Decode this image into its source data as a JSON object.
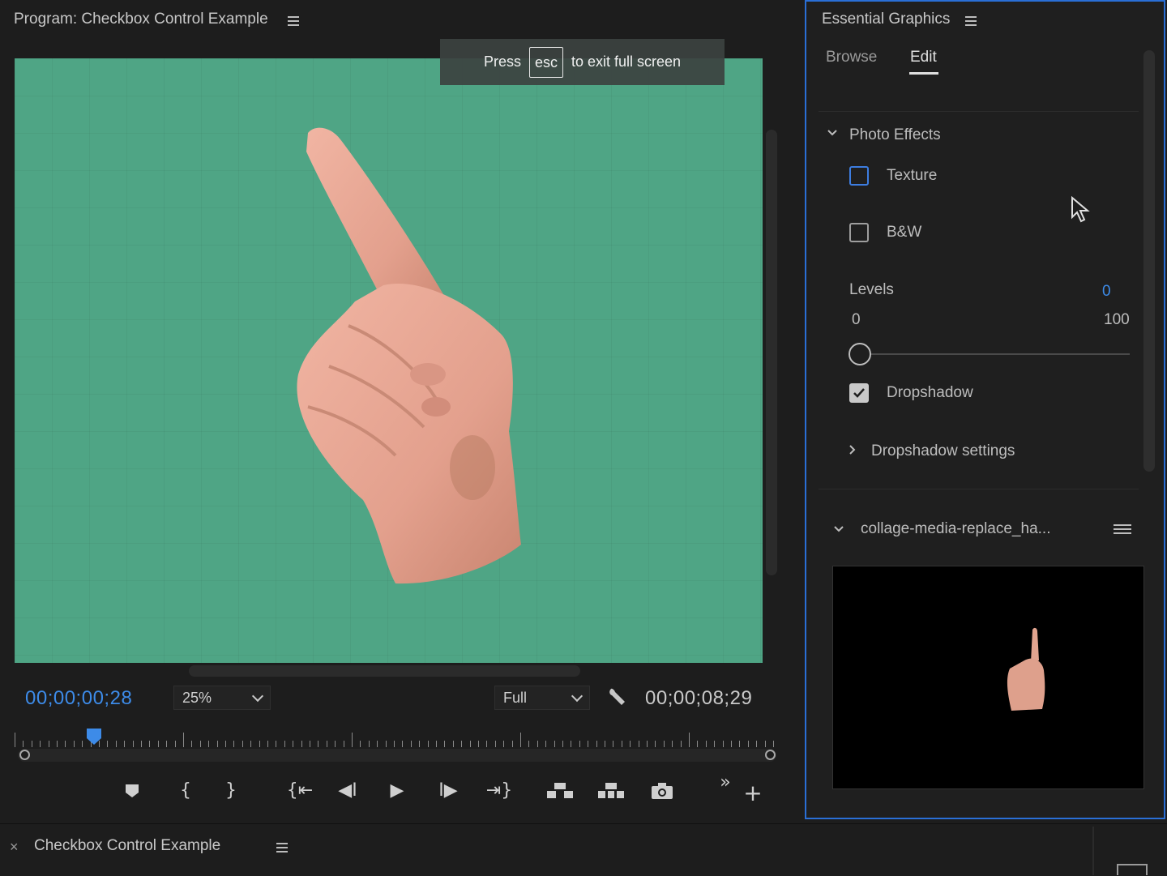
{
  "program": {
    "title": "Program: Checkbox Control Example",
    "esc_banner": {
      "press": "Press",
      "key": "esc",
      "rest": "to exit full screen"
    },
    "current_timecode": "00;00;00;28",
    "zoom": "25%",
    "resolution": "Full",
    "duration_timecode": "00;00;08;29",
    "colors": {
      "accent": "#3d8be8",
      "frame_bg": "#4fa585"
    }
  },
  "transport": {
    "icons": [
      "marker-icon",
      "mark-in-icon",
      "mark-out-icon",
      "go-to-in-icon",
      "step-back-icon",
      "play-icon",
      "step-forward-icon",
      "go-to-out-icon",
      "lift-icon",
      "extract-icon",
      "export-frame-icon",
      "more-icon",
      "add-button-icon"
    ]
  },
  "essential_graphics": {
    "title": "Essential Graphics",
    "tabs": [
      {
        "label": "Browse",
        "active": false
      },
      {
        "label": "Edit",
        "active": true
      }
    ],
    "section": {
      "label": "Photo Effects",
      "texture": {
        "label": "Texture",
        "checked": false
      },
      "bw": {
        "label": "B&W",
        "checked": false
      },
      "levels": {
        "label": "Levels",
        "value": "0",
        "min": "0",
        "max": "100"
      },
      "dropshadow": {
        "label": "Dropshadow",
        "checked": true
      },
      "dropshadow_settings": "Dropshadow settings"
    },
    "layer": {
      "label": "collage-media-replace_ha..."
    }
  },
  "timeline": {
    "close": "×",
    "tab_label": "Checkbox Control Example"
  }
}
